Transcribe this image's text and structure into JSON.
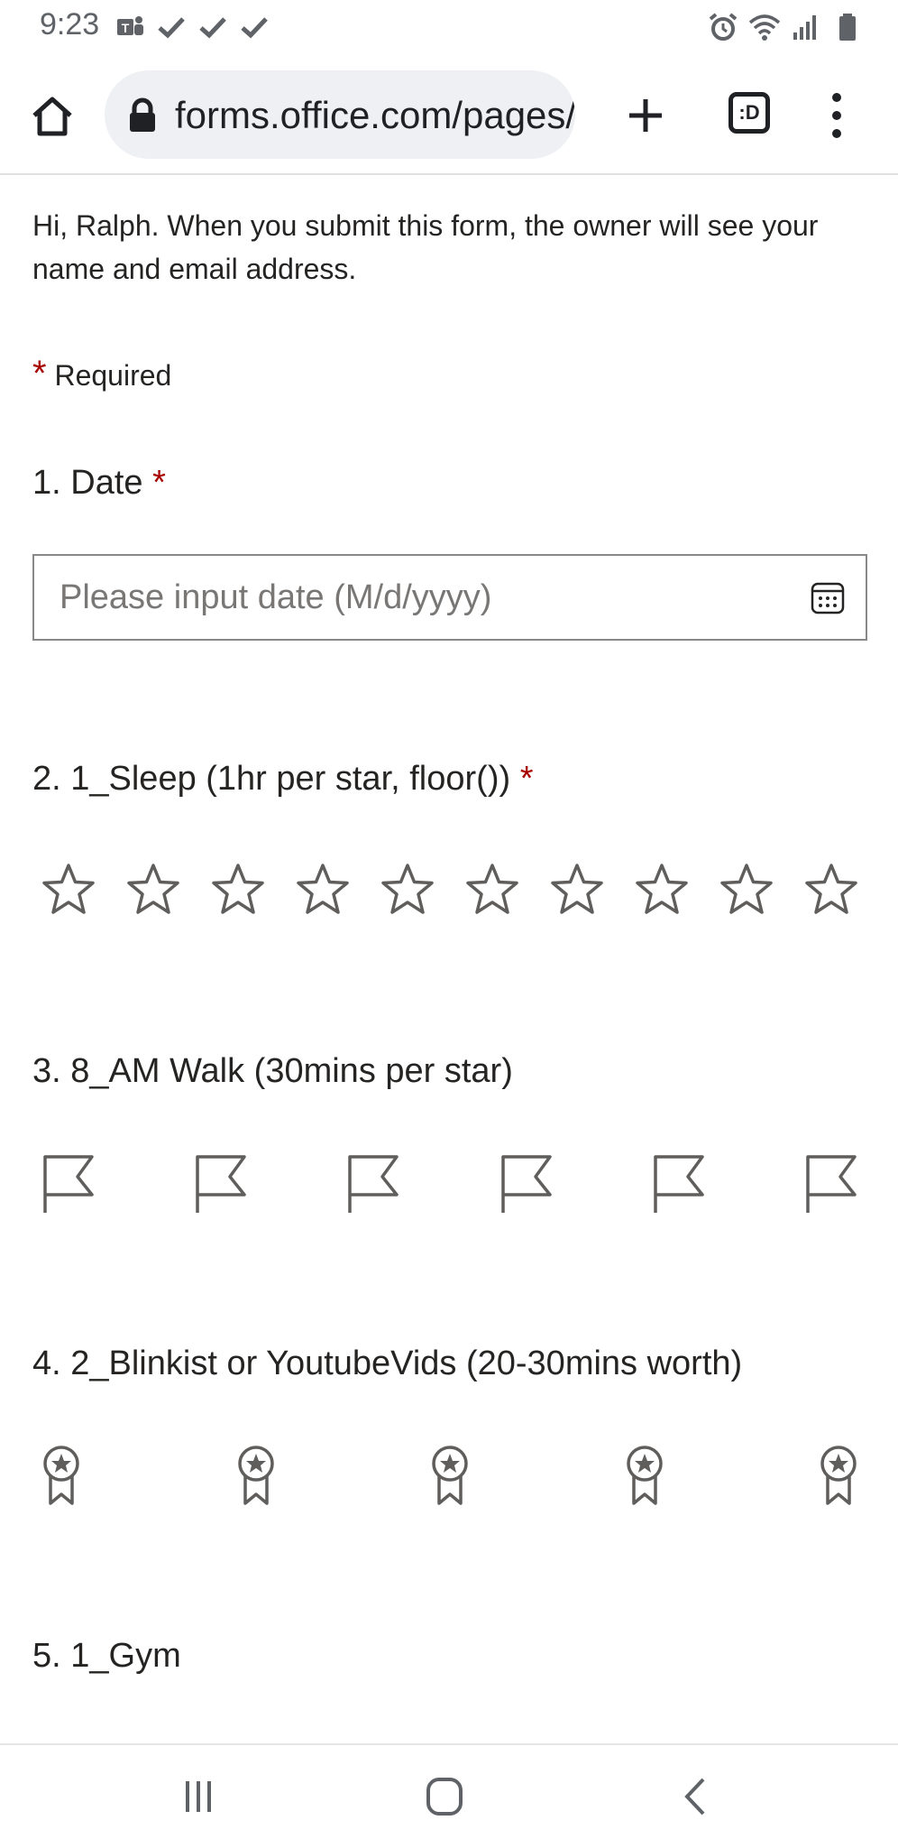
{
  "status": {
    "time": "9:23",
    "left_icons": [
      "teams-icon",
      "check-icon",
      "check-icon",
      "check-icon"
    ],
    "right_icons": [
      "alarm-icon",
      "wifi-icon",
      "signal-icon",
      "battery-icon"
    ]
  },
  "browser": {
    "url": "forms.office.com/pages/responsepage.aspx",
    "tabs_label": ":D",
    "icons": [
      "home-icon",
      "lock-icon",
      "plus-icon",
      "tabs-icon",
      "more-vert-icon"
    ]
  },
  "form": {
    "intro": "Hi, Ralph. When you submit this form, the owner will see your name and email address.",
    "required_mark": "*",
    "required_label": "Required",
    "questions": [
      {
        "label": "1. Date",
        "required": true
      },
      {
        "label": "2. 1_Sleep (1hr per star, floor())",
        "required": true
      },
      {
        "label": "3. 8_AM Walk (30mins per star)",
        "required": false
      },
      {
        "label": "4. 2_Blinkist or YoutubeVids (20-30mins worth)",
        "required": false
      },
      {
        "label": "5. 1_Gym",
        "required": false
      }
    ],
    "date_placeholder": "Please input date (M/d/yyyy)",
    "ratings": {
      "sleep": {
        "shape": "star-icon",
        "count": 10,
        "selected": 0
      },
      "walk": {
        "shape": "flag-icon",
        "count": 6,
        "selected": 0
      },
      "videos": {
        "shape": "ribbon-icon",
        "count": 5,
        "selected": 0
      }
    }
  },
  "nav": {
    "icons": [
      "recent-apps-icon",
      "home-nav-icon",
      "back-icon"
    ]
  },
  "colors": {
    "required": "#a80000",
    "text": "#252423",
    "icon": "#605e5c",
    "url_bar": "#eef0f3"
  }
}
